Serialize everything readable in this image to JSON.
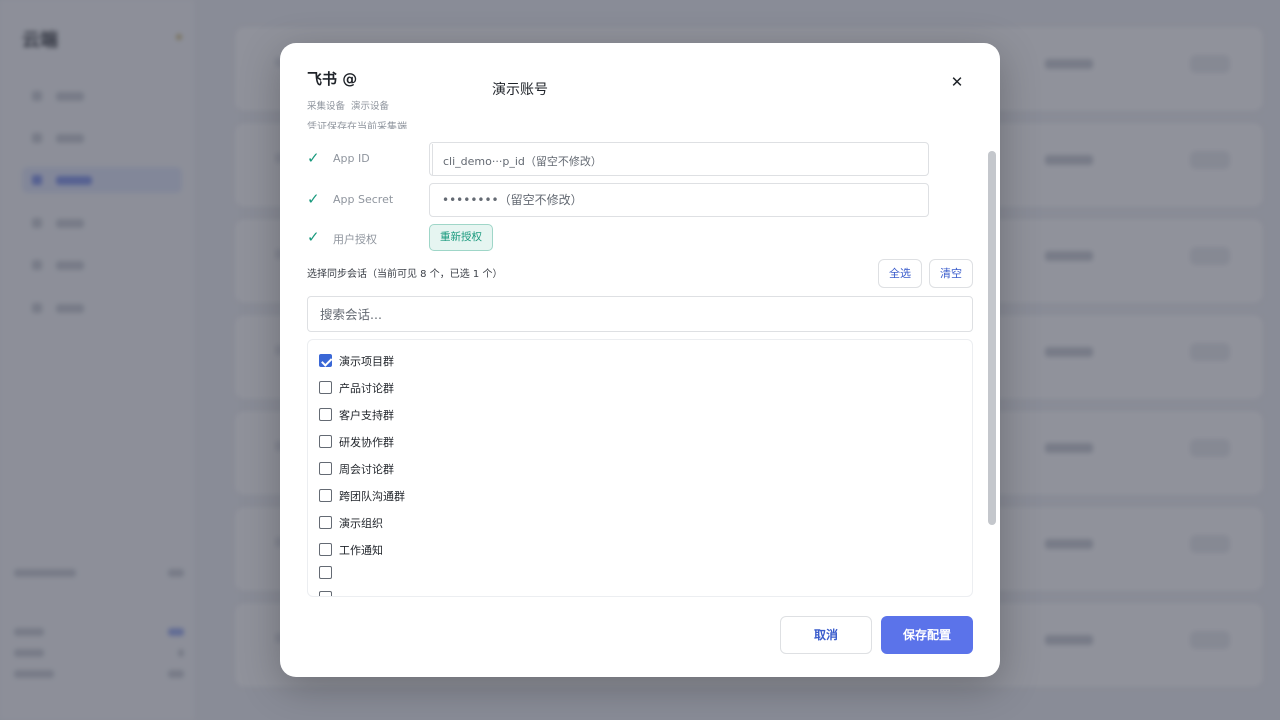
{
  "modal": {
    "title": "飞书 @",
    "account_name": "演示账号",
    "close_symbol": "✕",
    "subtitle_parts": [
      "采集设备",
      "演示设备"
    ],
    "note": "凭证保存在当前采集端"
  },
  "credentials": {
    "check_mark": "✓",
    "app_id": {
      "label": "App ID",
      "placeholder": "cli_demo···p_id（留空不修改）"
    },
    "app_secret": {
      "label": "App Secret",
      "placeholder": "••••••••（留空不修改）"
    },
    "user_auth": {
      "label": "用户授权",
      "button_label": "重新授权"
    }
  },
  "sync": {
    "label": "选择同步会话（当前可见 8 个，已选 1 个）",
    "select_all_label": "全选",
    "clear_label": "清空",
    "search_placeholder": "搜索会话...",
    "chats": [
      {
        "name": "演示项目群",
        "checked": true
      },
      {
        "name": "产品讨论群",
        "checked": false
      },
      {
        "name": "客户支持群",
        "checked": false
      },
      {
        "name": "研发协作群",
        "checked": false
      },
      {
        "name": "周会讨论群",
        "checked": false
      },
      {
        "name": "跨团队沟通群",
        "checked": false
      },
      {
        "name": "演示组织",
        "checked": false
      },
      {
        "name": "工作通知",
        "checked": false
      },
      {
        "name": "",
        "checked": false
      },
      {
        "name": "",
        "checked": false
      }
    ]
  },
  "footer": {
    "cancel_label": "取消",
    "save_label": "保存配置"
  },
  "colors": {
    "primary": "#5b73ea",
    "success_green": "#1a9a7e",
    "checkbox_blue": "#3a67d6"
  }
}
